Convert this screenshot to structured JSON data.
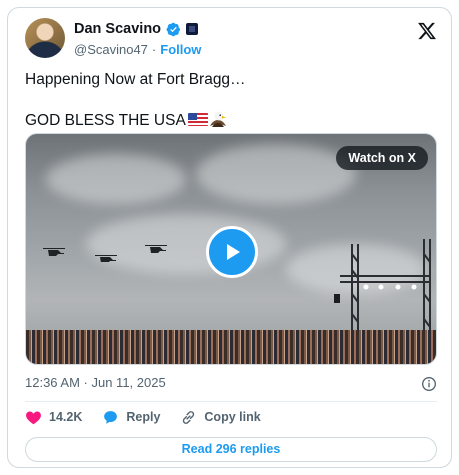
{
  "author": {
    "name": "Dan Scavino",
    "handle": "@Scavino47",
    "separator": "·",
    "follow_label": "Follow",
    "verified_color": "#1d9bf0"
  },
  "post": {
    "line1": "Happening Now at Fort Bragg…",
    "line2": "GOD BLESS THE USA"
  },
  "media": {
    "watch_label": "Watch on X",
    "play_icon": "play-icon"
  },
  "meta": {
    "timestamp": "12:36 AM · Jun 11, 2025"
  },
  "actions": {
    "likes": "14.2K",
    "reply_label": "Reply",
    "copy_link_label": "Copy link"
  },
  "replies": {
    "label": "Read 296 replies"
  },
  "colors": {
    "accent": "#1d9bf0",
    "like": "#f91880",
    "text": "#0f1419",
    "muted": "#536471"
  }
}
